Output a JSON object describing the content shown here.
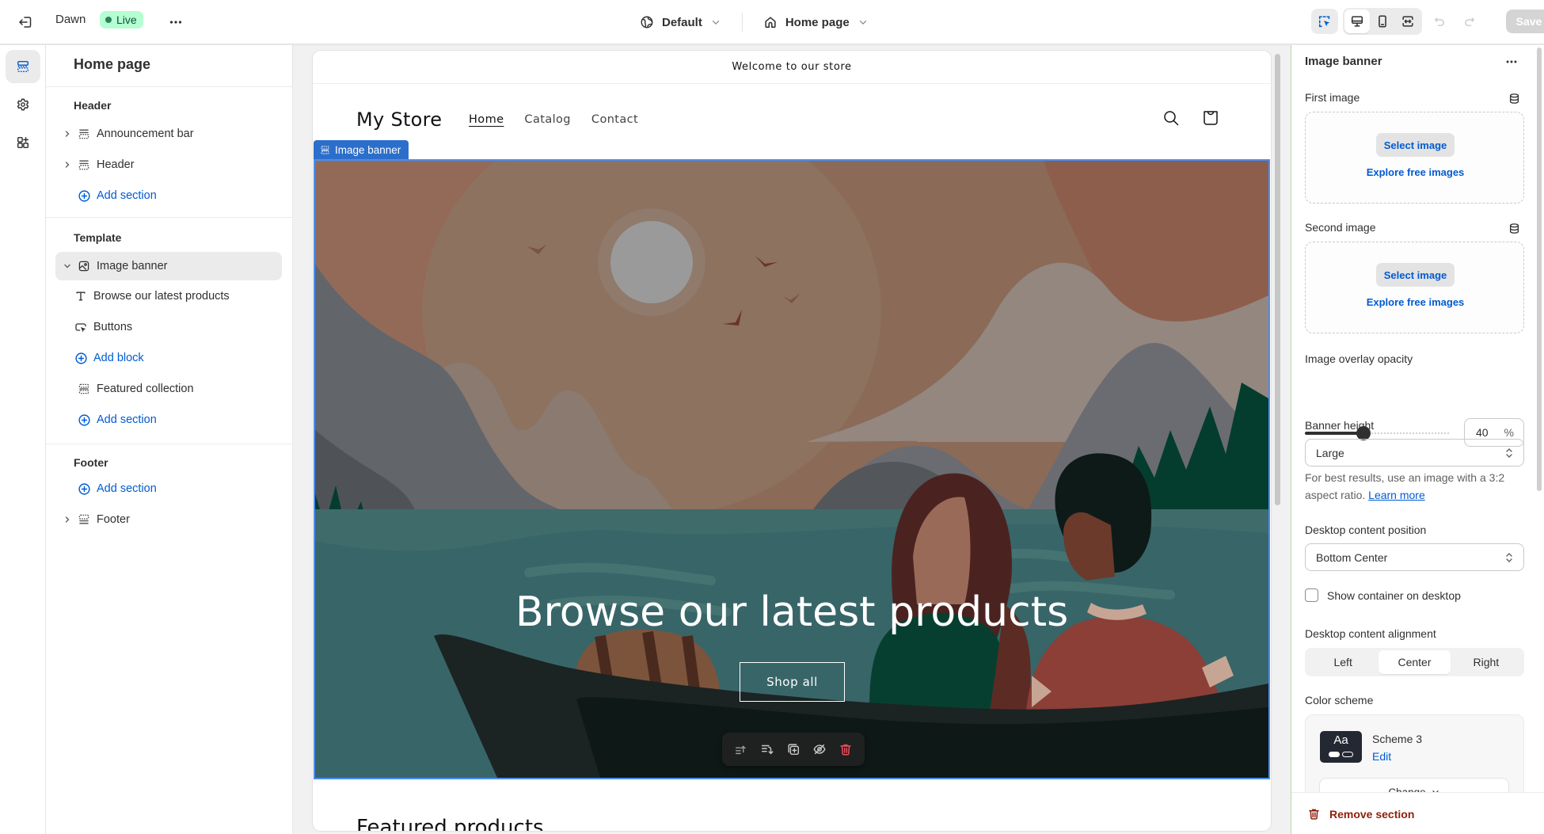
{
  "topbar": {
    "theme_name": "Dawn",
    "status_badge": "Live",
    "theme_dropdown": "Default",
    "page_dropdown": "Home page",
    "save_label": "Save"
  },
  "sidebar": {
    "title": "Home page",
    "groups": [
      {
        "title": "Header",
        "items": [
          {
            "label": "Announcement bar",
            "icon": "section-icon",
            "expandable": true
          },
          {
            "label": "Header",
            "icon": "section-icon",
            "expandable": true
          },
          {
            "label": "Add section",
            "icon": "add-circle-icon",
            "action": true
          }
        ]
      },
      {
        "title": "Template",
        "items": [
          {
            "label": "Image banner",
            "icon": "image-icon",
            "expanded": true,
            "selected": true
          },
          {
            "label": "Browse our latest products",
            "icon": "text-icon",
            "child": true
          },
          {
            "label": "Buttons",
            "icon": "button-icon",
            "child": true
          },
          {
            "label": "Add block",
            "icon": "add-circle-icon",
            "child": true,
            "action": true
          },
          {
            "label": "Featured collection",
            "icon": "section-icon"
          },
          {
            "label": "Add section",
            "icon": "add-circle-icon",
            "action": true
          }
        ]
      },
      {
        "title": "Footer",
        "items": [
          {
            "label": "Add section",
            "icon": "add-circle-icon",
            "action": true
          },
          {
            "label": "Footer",
            "icon": "footer-icon",
            "expandable": true
          }
        ]
      }
    ]
  },
  "preview": {
    "announcement": "Welcome to our store",
    "store_name": "My Store",
    "nav": [
      "Home",
      "Catalog",
      "Contact"
    ],
    "active_nav": "Home",
    "section_tag": "Image banner",
    "banner_heading": "Browse our latest products",
    "banner_button": "Shop all",
    "next_section_title": "Featured products"
  },
  "settings": {
    "title": "Image banner",
    "first_image_label": "First image",
    "second_image_label": "Second image",
    "select_image": "Select image",
    "explore_images": "Explore free images",
    "overlay_label": "Image overlay opacity",
    "overlay_value": "40",
    "overlay_unit": "%",
    "overlay_percent": 40,
    "banner_height_label": "Banner height",
    "banner_height_value": "Large",
    "help_text": "For best results, use an image with a 3:2 aspect ratio.",
    "help_link": "Learn more",
    "position_label": "Desktop content position",
    "position_value": "Bottom Center",
    "show_container_label": "Show container on desktop",
    "show_container_checked": false,
    "alignment_label": "Desktop content alignment",
    "alignment_options": [
      "Left",
      "Center",
      "Right"
    ],
    "alignment_selected": "Center",
    "color_scheme_label": "Color scheme",
    "scheme_swatch_text": "Aa",
    "scheme_name": "Scheme 3",
    "scheme_edit": "Edit",
    "scheme_change": "Change",
    "remove_section": "Remove section"
  },
  "colors": {
    "accent": "#005bd3",
    "selection": "#2c6ecb",
    "live_badge_bg": "#b4fed2",
    "danger": "#8e1f0b"
  }
}
